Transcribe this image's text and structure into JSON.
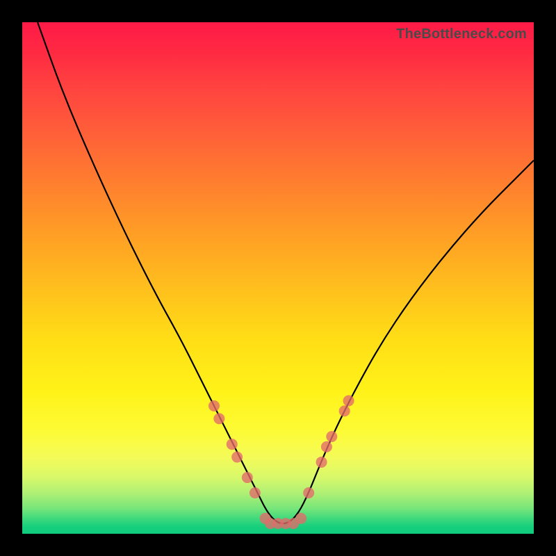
{
  "watermark": "TheBottleneck.com",
  "chart_data": {
    "type": "line",
    "title": "",
    "xlabel": "",
    "ylabel": "",
    "xlim": [
      0,
      100
    ],
    "ylim": [
      0,
      100
    ],
    "grid": false,
    "legend": false,
    "series": [
      {
        "name": "bottleneck-curve",
        "x": [
          3,
          8,
          14,
          20,
          26,
          31,
          35,
          38,
          41,
          44,
          46,
          48,
          50,
          52,
          54,
          56,
          58,
          61,
          65,
          70,
          76,
          83,
          90,
          97,
          100
        ],
        "y": [
          100,
          86,
          72,
          59,
          47,
          38,
          30,
          24,
          18,
          12,
          8,
          4,
          2,
          2,
          4,
          8,
          13,
          20,
          28,
          37,
          46,
          55,
          63,
          70,
          73
        ],
        "color": "#000000",
        "stroke_width": 2
      }
    ],
    "scatter_overlay": {
      "name": "marker-dots",
      "color": "#e36a6a",
      "points": [
        {
          "x": 37.5,
          "y": 25
        },
        {
          "x": 38.5,
          "y": 22.5
        },
        {
          "x": 41,
          "y": 17.5
        },
        {
          "x": 42,
          "y": 15
        },
        {
          "x": 44,
          "y": 11
        },
        {
          "x": 45.5,
          "y": 8
        },
        {
          "x": 47.5,
          "y": 3
        },
        {
          "x": 48.5,
          "y": 2
        },
        {
          "x": 50,
          "y": 2
        },
        {
          "x": 51.5,
          "y": 2
        },
        {
          "x": 53,
          "y": 2
        },
        {
          "x": 54.5,
          "y": 3
        },
        {
          "x": 56,
          "y": 8
        },
        {
          "x": 58.5,
          "y": 14
        },
        {
          "x": 59.5,
          "y": 17
        },
        {
          "x": 60.5,
          "y": 19
        },
        {
          "x": 63,
          "y": 24
        },
        {
          "x": 63.8,
          "y": 26
        }
      ]
    },
    "background_gradient": {
      "orientation": "vertical",
      "stops": [
        {
          "pos": 0,
          "color": "#ff1a47"
        },
        {
          "pos": 30,
          "color": "#ff7a30"
        },
        {
          "pos": 60,
          "color": "#ffde16"
        },
        {
          "pos": 85,
          "color": "#f4fb58"
        },
        {
          "pos": 100,
          "color": "#0ecb7d"
        }
      ]
    }
  }
}
